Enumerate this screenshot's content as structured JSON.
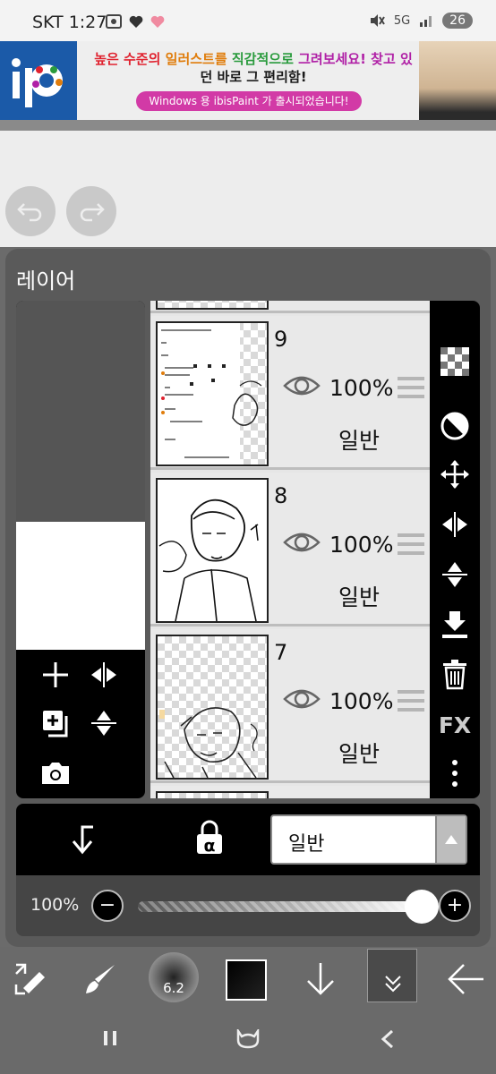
{
  "status_bar": {
    "time": "SKT 1:27",
    "network": "5G",
    "battery": "26"
  },
  "ad": {
    "line1_a": "높은 수준의 ",
    "line1_b": "일러스트를 ",
    "line1_c": "직감적으로 ",
    "line1_d": "그려보세요! 찾고 있",
    "line2": "던 바로 그 편리함!",
    "pill": "Windows 용 ibisPaint 가 출시되었습니다!"
  },
  "panel": {
    "title": "레이어",
    "layers": [
      {
        "number": "9",
        "opacity": "100%",
        "blend": "일반"
      },
      {
        "number": "8",
        "opacity": "100%",
        "blend": "일반"
      },
      {
        "number": "7",
        "opacity": "100%",
        "blend": "일반"
      }
    ],
    "blend_mode": "일반",
    "opacity_label": "100%",
    "opacity_value": 1.0,
    "fx_label": "FX",
    "alpha_label": "α"
  },
  "toolbar": {
    "brush_size": "6.2"
  },
  "colors": {
    "panel_bg": "#5a5a5a",
    "accent_pink": "#d23aa6",
    "brand_blue": "#1b5aa8"
  }
}
